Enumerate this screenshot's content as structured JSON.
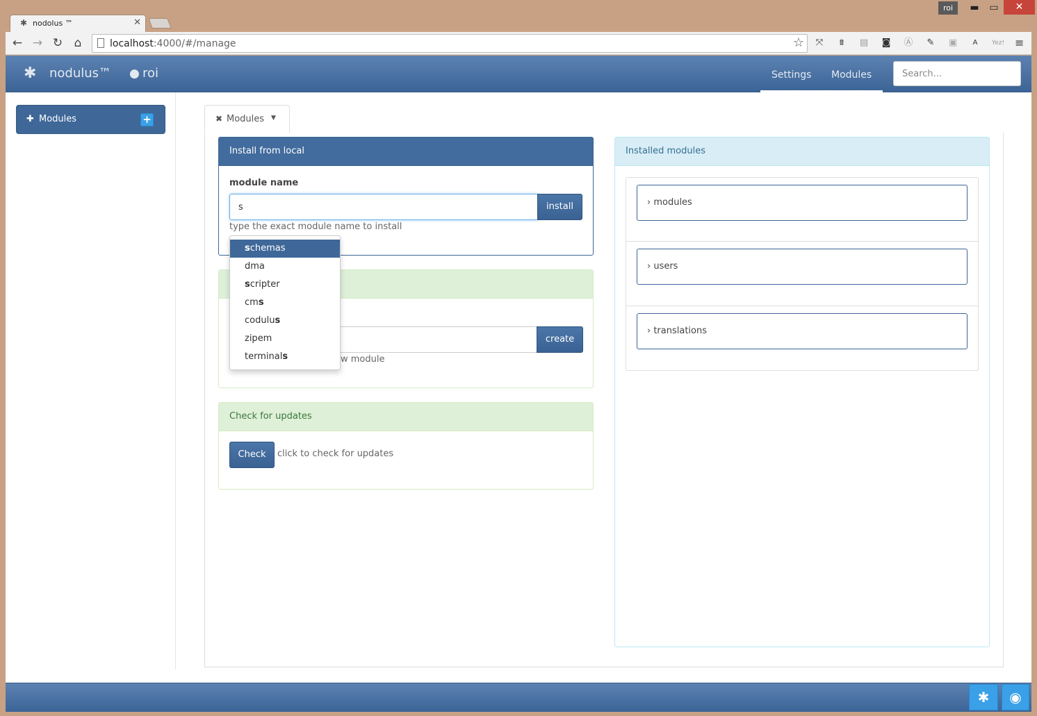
{
  "window": {
    "user_badge": "roi",
    "minimize_icon": "▬",
    "maximize_icon": "▭",
    "close_icon": "✕"
  },
  "browser": {
    "tab_title": "nodolus ™",
    "tab_close": "✕",
    "url_host": "localhost",
    "url_rest": ":4000/#/manage",
    "back": "←",
    "forward": "→",
    "reload": "↻",
    "home": "⌂",
    "star": "☆",
    "menu": "≡",
    "extensions": [
      "⤧",
      "⩩",
      "▤",
      "◙",
      "Ⓐ",
      "✎",
      "▣",
      "A",
      "Yez!"
    ]
  },
  "app": {
    "brand": "nodulus™",
    "brand_icon": "✱",
    "user_icon": "●",
    "user": "roi",
    "nav": [
      "Settings",
      "Modules"
    ],
    "search_placeholder": "Search...",
    "sidebar": {
      "icon": "✚",
      "label": "Modules",
      "plus": "+"
    },
    "main_tab": {
      "close": "✖",
      "label": "Modules",
      "caret": "▼"
    },
    "install_panel": {
      "title": "Install from local",
      "field_label": "module name",
      "field_value": "s",
      "button": "install",
      "help": "type the exact module name to install"
    },
    "create_panel": {
      "button": "create",
      "help_tail": "w module"
    },
    "autocomplete": [
      {
        "pre": "",
        "bold": "s",
        "post": "chemas"
      },
      {
        "pre": "dma",
        "bold": "",
        "post": ""
      },
      {
        "pre": "",
        "bold": "s",
        "post": "cripter"
      },
      {
        "pre": "cm",
        "bold": "s",
        "post": ""
      },
      {
        "pre": "codulu",
        "bold": "s",
        "post": ""
      },
      {
        "pre": "zipem",
        "bold": "",
        "post": ""
      },
      {
        "pre": "terminal",
        "bold": "s",
        "post": ""
      }
    ],
    "update_panel": {
      "title": "Check for updates",
      "button": "Check",
      "help": "click to check for updates"
    },
    "installed_panel": {
      "title": "Installed modules",
      "modules": [
        "› modules",
        "› users",
        "› translations"
      ]
    },
    "footer": {
      "octopus_icon": "✱",
      "github_icon": "◉"
    }
  }
}
